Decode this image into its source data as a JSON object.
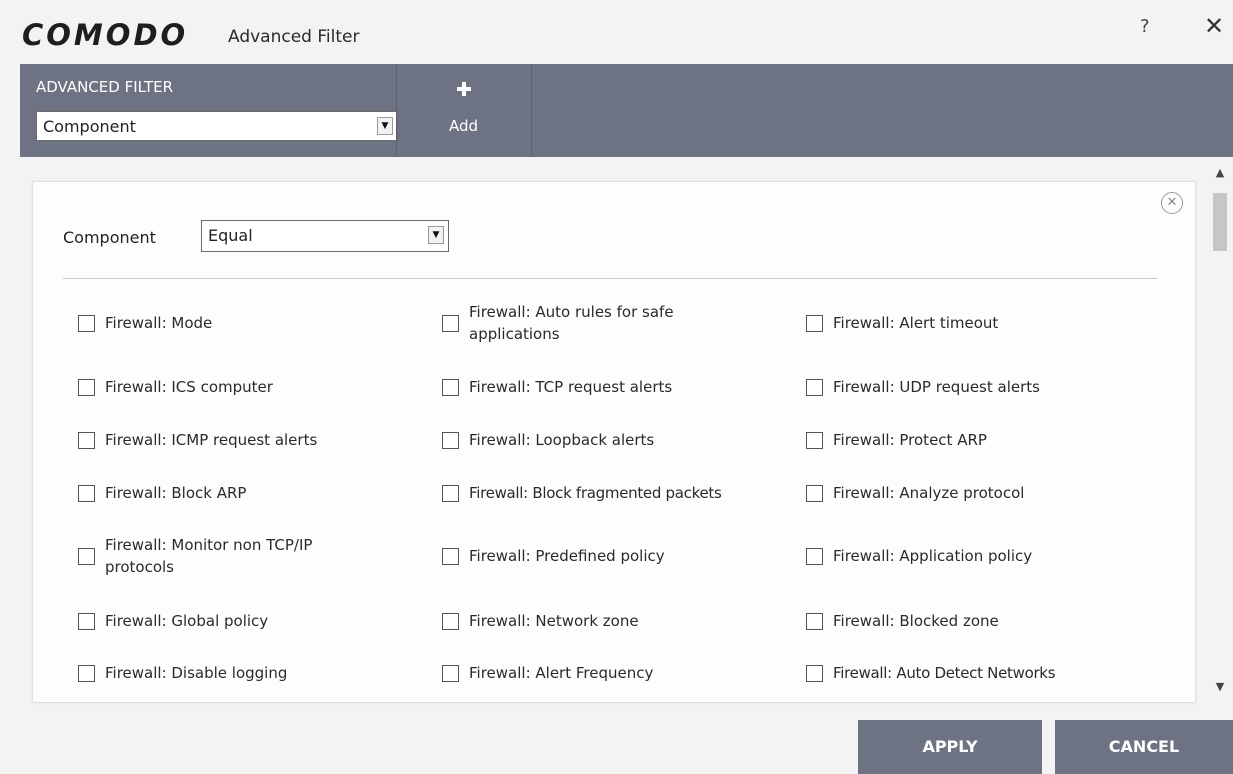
{
  "window": {
    "brand": "COMODO",
    "title": "Advanced Filter",
    "help_label": "?",
    "close_label": "✕"
  },
  "toolbar": {
    "filter_heading": "ADVANCED FILTER",
    "filter_value": "Component",
    "add_label": "Add"
  },
  "filter": {
    "label": "Component",
    "operator_value": "Equal",
    "options": [
      "Firewall: Mode",
      "Firewall: Auto rules for safe applications",
      "Firewall: Alert timeout",
      "Firewall: ICS computer",
      "Firewall: TCP request alerts",
      "Firewall: UDP request alerts",
      "Firewall: ICMP request alerts",
      "Firewall: Loopback alerts",
      "Firewall: Protect ARP",
      "Firewall: Block ARP",
      "Firewall: Block fragmented packets",
      "Firewall: Analyze protocol",
      "Firewall: Monitor non TCP/IP protocols",
      "Firewall: Predefined policy",
      "Firewall: Application policy",
      "Firewall: Global policy",
      "Firewall: Network zone",
      "Firewall: Blocked zone",
      "Firewall: Disable logging",
      "Firewall: Alert Frequency",
      "Firewall: Auto Detect Networks"
    ]
  },
  "footer": {
    "apply_label": "APPLY",
    "cancel_label": "CANCEL"
  },
  "colors": {
    "toolbar_bg": "#6d7382",
    "button_bg": "#6d7382",
    "panel_bg": "#fcfefe",
    "window_bg": "#f3f3f3"
  },
  "icons": {
    "add": "plus-icon",
    "remove_condition": "circle-x-icon",
    "dropdown": "triangle-down-icon"
  }
}
